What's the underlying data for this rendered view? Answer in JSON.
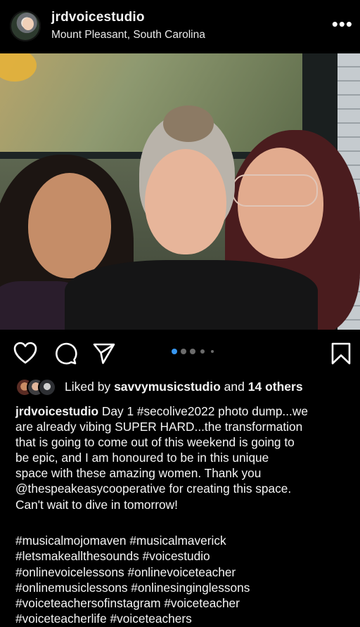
{
  "header": {
    "username": "jrdvoicestudio",
    "location": "Mount Pleasant, South Carolina",
    "more_label": "•••"
  },
  "post": {
    "image_description_icon": "group-selfie-photo",
    "carousel": {
      "count": 5,
      "active_index": 0,
      "active_color": "#3897f0"
    }
  },
  "actions": {
    "like_icon": "heart-icon",
    "comment_icon": "comment-icon",
    "share_icon": "send-icon",
    "save_icon": "bookmark-icon"
  },
  "likes": {
    "prefix": "Liked by",
    "user": "savvymusicstudio",
    "connector": "and",
    "others": "14 others"
  },
  "caption": {
    "username": "jrdvoicestudio",
    "lines": [
      "Day 1 #secolive2022 photo dump...we",
      "are already vibing SUPER HARD...the transformation",
      "that is going to come out of this weekend is going to",
      "be epic, and I am honoured to be in this unique",
      "space with these amazing women. Thank you",
      "@thespeakeasycooperative for creating this space.",
      "Can't wait to dive in tomorrow!"
    ],
    "hashtag_lines": [
      "#musicalmojomaven #musicalmaverick",
      "#letsmakeallthesounds #voicestudio",
      "#onlinevoicelessons #onlinevoiceteacher",
      "#onlinemusiclessons #onlinesinginglessons",
      "#voiceteachersofinstagram #voiceteacher",
      "#voiceteacherlife #voiceteachers"
    ]
  },
  "colors": {
    "background": "#000000",
    "text": "#f5f5f5"
  }
}
